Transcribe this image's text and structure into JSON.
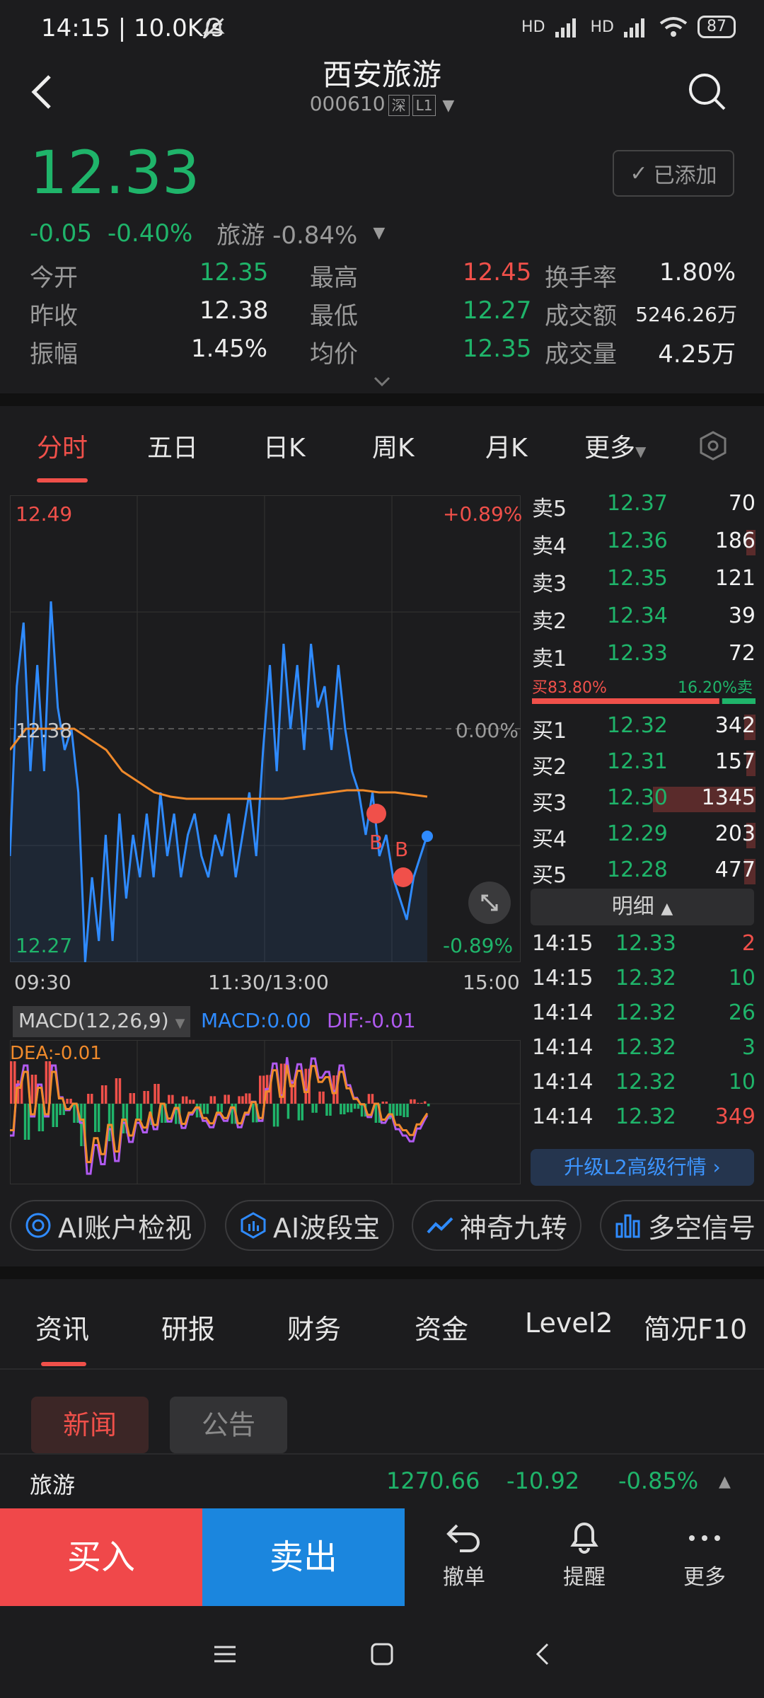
{
  "status_bar": {
    "time": "14:15 | 10.0K/s",
    "network": "HD",
    "battery": "87"
  },
  "header": {
    "title": "西安旅游",
    "code": "000610",
    "exchange": "深",
    "level": "L1"
  },
  "quote": {
    "price": "12.33",
    "change": "-0.05",
    "change_pct": "-0.40%",
    "sector_name": "旅游",
    "sector_pct": "-0.84%",
    "added_label": "已添加",
    "stats": [
      {
        "label": "今开",
        "value": "12.35"
      },
      {
        "label": "最高",
        "value": "12.45"
      },
      {
        "label": "换手率",
        "value": "1.80%"
      },
      {
        "label": "昨收",
        "value": "12.38"
      },
      {
        "label": "最低",
        "value": "12.27"
      },
      {
        "label": "成交额",
        "value": "5246.26万"
      },
      {
        "label": "振幅",
        "value": "1.45%"
      },
      {
        "label": "均价",
        "value": "12.35"
      },
      {
        "label": "成交量",
        "value": "4.25万"
      }
    ]
  },
  "chart_tabs": [
    "分时",
    "五日",
    "日K",
    "周K",
    "月K",
    "更多"
  ],
  "intraday": {
    "y_max": "12.49",
    "y_mid": "12.38",
    "y_min": "12.27",
    "pct_max": "+0.89%",
    "pct_mid": "0.00%",
    "pct_min": "-0.89%",
    "x_labels": [
      "09:30",
      "11:30/13:00",
      "15:00"
    ],
    "marker": "B",
    "macd_title": "MACD(12,26,9)",
    "macd_val": "MACD:0.00",
    "dif_val": "DIF:-0.01",
    "dea_val": "DEA:-0.01"
  },
  "chart_data": {
    "type": "line",
    "ylim": [
      12.27,
      12.49
    ],
    "baseline": 12.38,
    "series": [
      {
        "values": [
          12.32,
          12.4,
          12.43,
          12.36,
          12.41,
          12.36,
          12.44,
          12.39,
          12.37,
          12.38,
          12.35,
          12.27,
          12.31,
          12.28,
          12.33,
          12.28,
          12.34,
          12.3,
          12.33,
          12.31,
          12.34,
          12.31,
          12.35,
          12.32,
          12.34,
          12.31,
          12.33,
          12.34,
          12.32,
          12.31,
          12.33,
          12.32,
          12.34,
          12.31,
          12.33,
          12.35,
          12.32,
          12.37,
          12.41,
          12.36,
          12.42,
          12.38,
          12.41,
          12.37,
          12.42,
          12.39,
          12.4,
          12.37,
          12.41,
          12.38,
          12.36,
          12.35,
          12.33,
          12.35,
          12.32,
          12.33,
          12.31,
          12.3,
          12.29,
          12.31,
          12.32,
          12.33
        ]
      },
      {
        "values": [
          12.37,
          12.38,
          12.38,
          12.38,
          12.38,
          12.375,
          12.37,
          12.36,
          12.355,
          12.35,
          12.348,
          12.347,
          12.347,
          12.347,
          12.347,
          12.347,
          12.347,
          12.347,
          12.348,
          12.349,
          12.35,
          12.351,
          12.351,
          12.35,
          12.35,
          12.349,
          12.348
        ]
      }
    ]
  },
  "order_book": {
    "asks": [
      {
        "label": "卖5",
        "price": "12.37",
        "vol": "70",
        "w": 0
      },
      {
        "label": "卖4",
        "price": "12.36",
        "vol": "186",
        "w": 0.04
      },
      {
        "label": "卖3",
        "price": "12.35",
        "vol": "121",
        "w": 0
      },
      {
        "label": "卖2",
        "price": "12.34",
        "vol": "39",
        "w": 0
      },
      {
        "label": "卖1",
        "price": "12.33",
        "vol": "72",
        "w": 0
      }
    ],
    "buy_ratio": "买83.80%",
    "sell_ratio": "16.20%卖",
    "buy_ratio_value": 0.838,
    "bids": [
      {
        "label": "买1",
        "price": "12.32",
        "vol": "342",
        "w": 0.05
      },
      {
        "label": "买2",
        "price": "12.31",
        "vol": "157",
        "w": 0.04
      },
      {
        "label": "买3",
        "price": "12.30",
        "vol": "1345",
        "w": 0.46
      },
      {
        "label": "买4",
        "price": "12.29",
        "vol": "203",
        "w": 0.04
      },
      {
        "label": "买5",
        "price": "12.28",
        "vol": "477",
        "w": 0.05
      }
    ],
    "detail_label": "明细",
    "ticks": [
      {
        "time": "14:15",
        "price": "12.33",
        "vol": "2",
        "side": "red"
      },
      {
        "time": "14:15",
        "price": "12.32",
        "vol": "10",
        "side": "green"
      },
      {
        "time": "14:14",
        "price": "12.32",
        "vol": "26",
        "side": "green"
      },
      {
        "time": "14:14",
        "price": "12.32",
        "vol": "3",
        "side": "green"
      },
      {
        "time": "14:14",
        "price": "12.32",
        "vol": "10",
        "side": "green"
      },
      {
        "time": "14:14",
        "price": "12.32",
        "vol": "349",
        "side": "red"
      }
    ],
    "upgrade_label": "升级L2高级行情 ›"
  },
  "ai_tools": [
    "AI账户检视",
    "AI波段宝",
    "神奇九转",
    "多空信号"
  ],
  "info_tabs": [
    "资讯",
    "研报",
    "财务",
    "资金",
    "Level2",
    "简况F10"
  ],
  "news_pills": [
    "新闻",
    "公告"
  ],
  "sector_bar": {
    "name": "旅游",
    "value": "1270.66",
    "change": "-10.92",
    "pct": "-0.85%"
  },
  "bottom_actions": {
    "buy": "买入",
    "sell": "卖出",
    "cancel": "撤单",
    "alert": "提醒",
    "more": "更多"
  }
}
